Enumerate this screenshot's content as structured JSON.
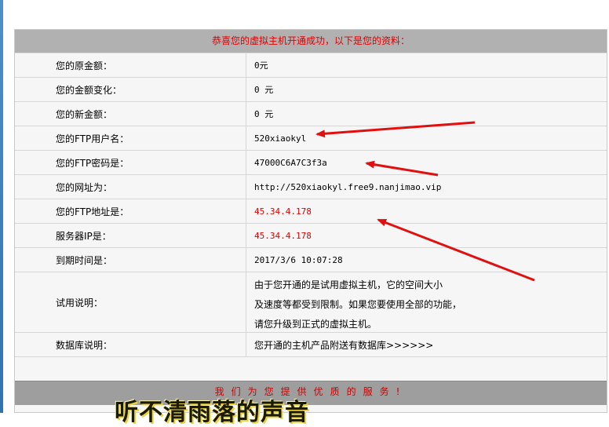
{
  "header": {
    "message": "恭喜您的虚拟主机开通成功，以下是您的资料："
  },
  "rows": [
    {
      "label": "您的原金额：",
      "value": "0元"
    },
    {
      "label": "您的金额变化：",
      "value": "0 元"
    },
    {
      "label": "您的新金额：",
      "value": "0 元"
    },
    {
      "label": "您的FTP用户名：",
      "value": "520xiaokyl"
    },
    {
      "label": "您的FTP密码是：",
      "value": "47000C6A7C3f3a"
    },
    {
      "label": "您的网址为：",
      "value": "http://520xiaokyl.free9.nanjimao.vip"
    },
    {
      "label": "您的FTP地址是：",
      "value": "45.34.4.178"
    },
    {
      "label": "服务器IP是：",
      "value": "45.34.4.178"
    },
    {
      "label": "到期时间是：",
      "value": "2017/3/6 10:07:28"
    }
  ],
  "trial": {
    "label": "试用说明：",
    "lines": [
      "由于您开通的是试用虚拟主机，它的空间大小",
      "及速度等都受到限制。如果您要使用全部的功能，",
      "请您升级到正式的虚拟主机。"
    ]
  },
  "database": {
    "label": "数据库说明：",
    "value": "您开通的主机产品附送有数据库>>>>>>"
  },
  "footer": {
    "slogan": "我们为您提供优质的服务!"
  },
  "overlay": {
    "caption": "听不清雨落的声音"
  },
  "colors": {
    "highlight_red": "#e00000",
    "header_bg": "#b1b1b1",
    "arrow": "#e01010"
  }
}
